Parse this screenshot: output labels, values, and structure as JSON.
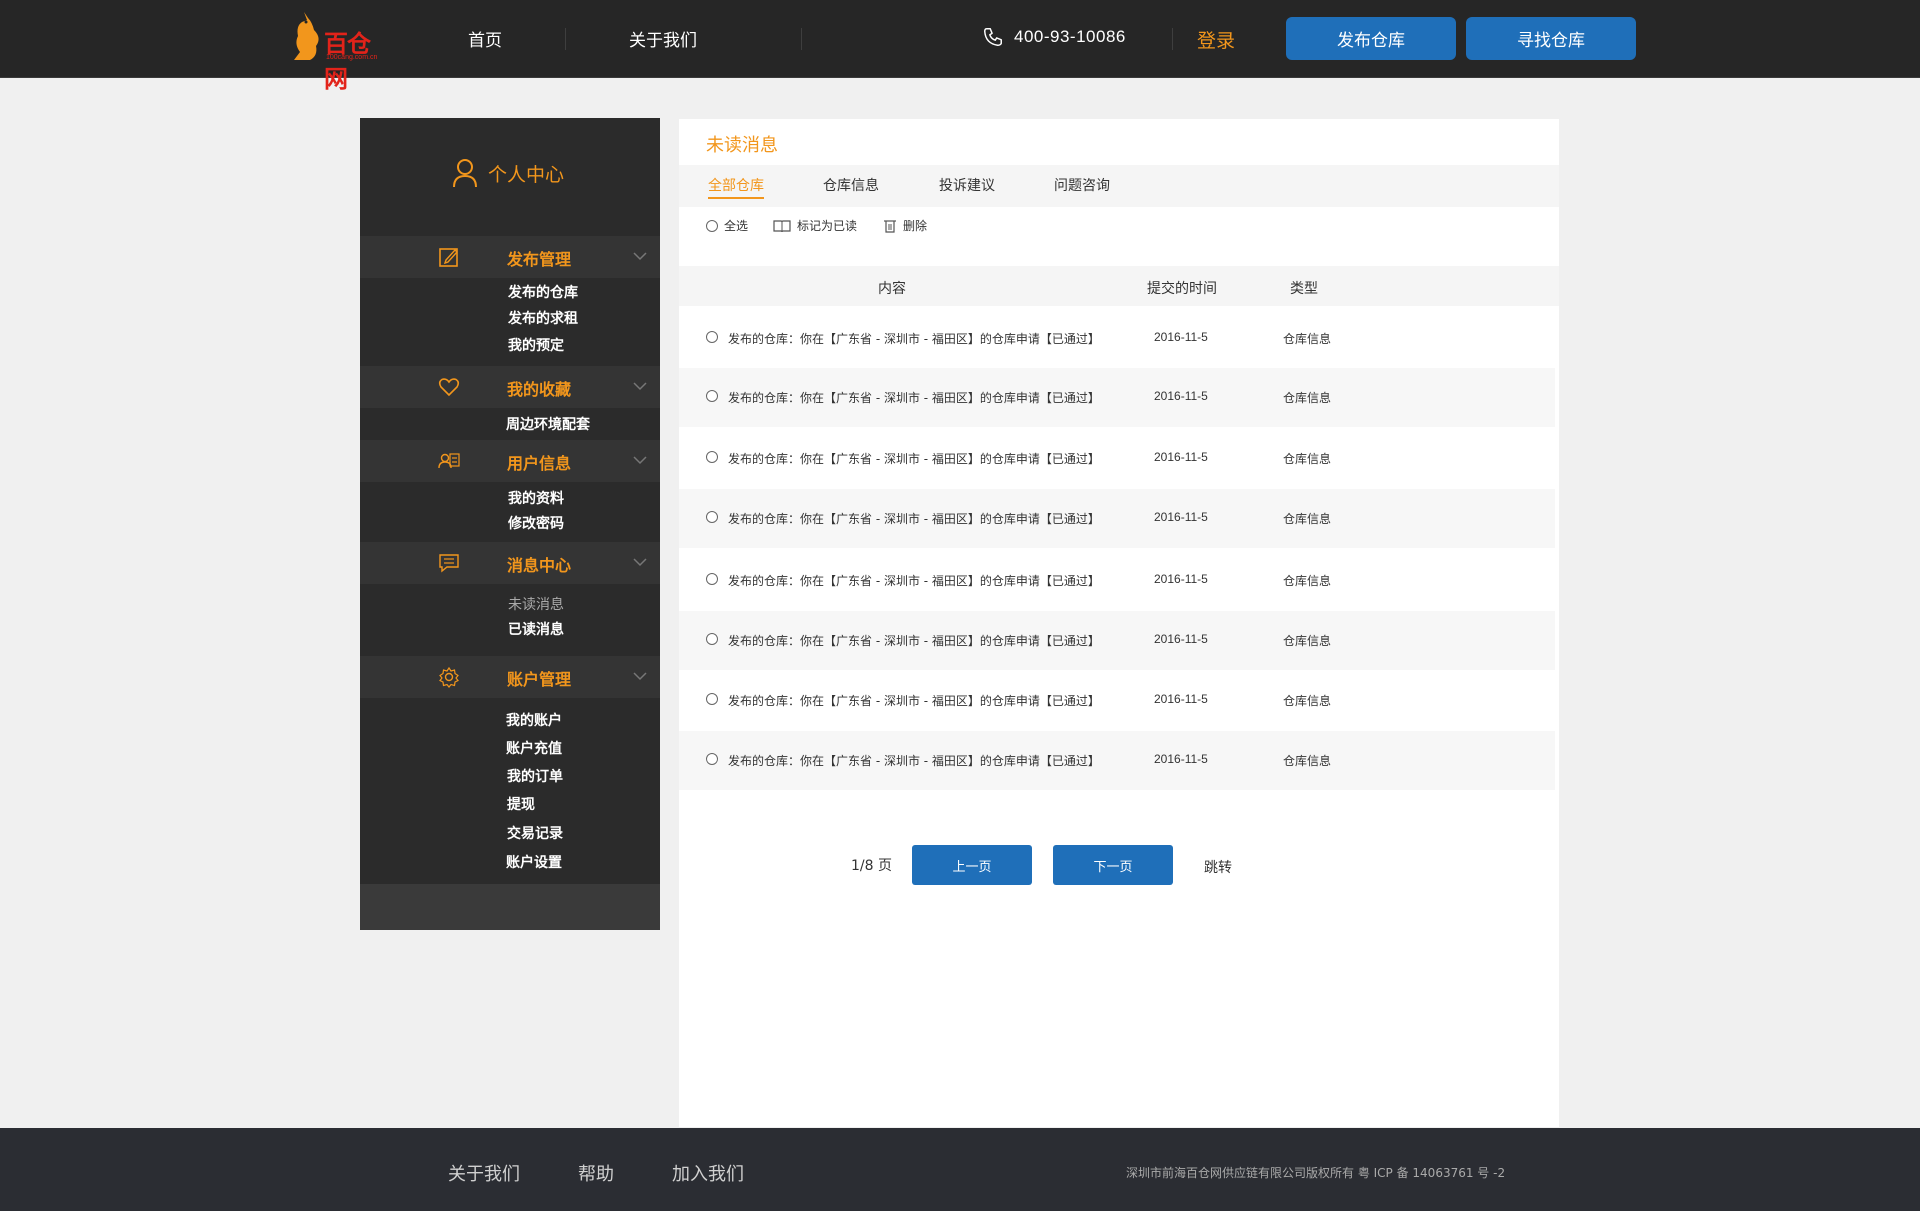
{
  "header": {
    "logo_text": "百仓网",
    "logo_sub": "100cang.com.cn",
    "nav": [
      "首页",
      "关于我们"
    ],
    "phone": "400-93-10086",
    "login": "登录",
    "publish_btn": "发布仓库",
    "find_btn": "寻找仓库",
    "accent": "#f2961c",
    "button_color": "#1f6fb9"
  },
  "sidebar": {
    "title": "个人中心",
    "sections": [
      {
        "label": "发布管理",
        "icon": "edit-icon",
        "items": [
          "发布的仓库",
          "发布的求租",
          "我的预定"
        ]
      },
      {
        "label": "我的收藏",
        "icon": "heart-icon",
        "items": [
          "周边环境配套"
        ]
      },
      {
        "label": "用户信息",
        "icon": "user-card-icon",
        "items": [
          "我的资料",
          "修改密码"
        ]
      },
      {
        "label": "消息中心",
        "icon": "message-icon",
        "items": [
          "未读消息",
          "已读消息"
        ]
      },
      {
        "label": "账户管理",
        "icon": "gear-icon",
        "items": [
          "我的账户",
          "账户充值",
          "我的订单",
          "提现",
          "交易记录",
          "账户设置"
        ]
      }
    ]
  },
  "main": {
    "title": "未读消息",
    "tabs": [
      "全部仓库",
      "仓库信息",
      "投诉建议",
      "问题咨询"
    ],
    "toolbar": {
      "select_all": "全选",
      "mark_read": "标记为已读",
      "delete": "删除"
    },
    "columns": [
      "内容",
      "提交的时间",
      "类型"
    ],
    "rows": [
      {
        "content": "发布的仓库：你在【广东省 - 深圳市 - 福田区】的仓库申请【已通过】",
        "date": "2016-11-5",
        "type": "仓库信息"
      },
      {
        "content": "发布的仓库：你在【广东省 - 深圳市 - 福田区】的仓库申请【已通过】",
        "date": "2016-11-5",
        "type": "仓库信息"
      },
      {
        "content": "发布的仓库：你在【广东省 - 深圳市 - 福田区】的仓库申请【已通过】",
        "date": "2016-11-5",
        "type": "仓库信息"
      },
      {
        "content": "发布的仓库：你在【广东省 - 深圳市 - 福田区】的仓库申请【已通过】",
        "date": "2016-11-5",
        "type": "仓库信息"
      },
      {
        "content": "发布的仓库：你在【广东省 - 深圳市 - 福田区】的仓库申请【已通过】",
        "date": "2016-11-5",
        "type": "仓库信息"
      },
      {
        "content": "发布的仓库：你在【广东省 - 深圳市 - 福田区】的仓库申请【已通过】",
        "date": "2016-11-5",
        "type": "仓库信息"
      },
      {
        "content": "发布的仓库：你在【广东省 - 深圳市 - 福田区】的仓库申请【已通过】",
        "date": "2016-11-5",
        "type": "仓库信息"
      },
      {
        "content": "发布的仓库：你在【广东省 - 深圳市 - 福田区】的仓库申请【已通过】",
        "date": "2016-11-5",
        "type": "仓库信息"
      }
    ],
    "pager": {
      "info": "1/8 页",
      "prev": "上一页",
      "next": "下一页",
      "jump": "跳转"
    }
  },
  "footer": {
    "links": [
      "关于我们",
      "帮助",
      "加入我们"
    ],
    "copyright": "深圳市前海百仓网供应链有限公司版权所有   粤 ICP 备 14063761 号 -2"
  }
}
